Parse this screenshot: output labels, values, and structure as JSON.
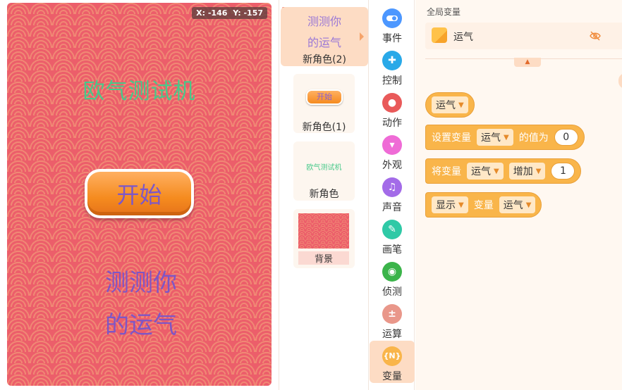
{
  "stage": {
    "coord_x": "X: -146",
    "coord_y": "Y: -157",
    "title_text": "欧气测试机",
    "start_button": "开始",
    "fortune_line1": "测测你",
    "fortune_line2": "的运气"
  },
  "sprites": {
    "items": [
      {
        "thumb_line1": "测测你",
        "thumb_line2": "的运气",
        "label": "新角色(2)"
      },
      {
        "thumb_text": "开始",
        "label": "新角色(1)"
      },
      {
        "thumb_text": "欧气测试机",
        "label": "新角色"
      },
      {
        "label": "背景"
      }
    ]
  },
  "categories": [
    {
      "label": "事件",
      "icon": "toggle-icon",
      "color": "#4c97ff"
    },
    {
      "label": "控制",
      "icon": "gamepad-icon",
      "color": "#29a9e8"
    },
    {
      "label": "动作",
      "icon": "ghost-icon",
      "color": "#e95a5a"
    },
    {
      "label": "外观",
      "icon": "shirt-icon",
      "color": "#ef6bd6"
    },
    {
      "label": "声音",
      "icon": "music-icon",
      "color": "#a36be8"
    },
    {
      "label": "画笔",
      "icon": "pen-icon",
      "color": "#2fc9a6"
    },
    {
      "label": "侦测",
      "icon": "target-icon",
      "color": "#3bb44a"
    },
    {
      "label": "运算",
      "icon": "operators-icon",
      "color": "#e9978a"
    },
    {
      "label": "变量",
      "icon": "variable-icon",
      "color": "#f9b54a"
    }
  ],
  "blocks_panel": {
    "section_title": "全局变量",
    "variable_name": "运气",
    "reporter": {
      "var": "运气"
    },
    "set_block": {
      "prefix": "设置变量",
      "var": "运气",
      "middle": "的值为",
      "value": "0"
    },
    "change_block": {
      "prefix": "将变量",
      "var": "运气",
      "op": "增加",
      "value": "1"
    },
    "show_block": {
      "action": "显示",
      "middle": "变量",
      "var": "运气"
    }
  },
  "colors": {
    "stage_bg": "#ec5e6a",
    "accent": "#f9b54a",
    "selected": "#fddcc4"
  }
}
